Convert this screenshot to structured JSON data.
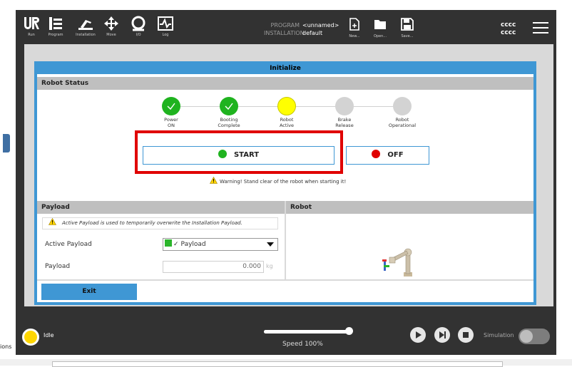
{
  "header": {
    "nav": [
      {
        "label": "Run",
        "icon": "ur-logo-icon"
      },
      {
        "label": "Program",
        "icon": "program-icon"
      },
      {
        "label": "Installation",
        "icon": "installation-icon"
      },
      {
        "label": "Move",
        "icon": "move-icon"
      },
      {
        "label": "I/O",
        "icon": "io-icon"
      },
      {
        "label": "Log",
        "icon": "log-icon"
      }
    ],
    "program_label": "PROGRAM",
    "program_value": "<unnamed>",
    "installation_label": "INSTALLATION",
    "installation_value": "default",
    "file_actions": [
      {
        "label": "New...",
        "icon": "new-file-icon"
      },
      {
        "label": "Open...",
        "icon": "open-folder-icon"
      },
      {
        "label": "Save...",
        "icon": "save-icon"
      }
    ],
    "user_line1": "cccc",
    "user_line2": "cccc"
  },
  "dialog": {
    "title": "Initialize",
    "robot_status": {
      "heading": "Robot Status",
      "steps": [
        {
          "line1": "Power",
          "line2": "ON",
          "state": "done"
        },
        {
          "line1": "Booting",
          "line2": "Complete",
          "state": "done"
        },
        {
          "line1": "Robot",
          "line2": "Active",
          "state": "active"
        },
        {
          "line1": "Brake",
          "line2": "Release",
          "state": "pending"
        },
        {
          "line1": "Robot",
          "line2": "Operational",
          "state": "pending"
        }
      ],
      "start_label": "START",
      "off_label": "OFF",
      "warning": "Warning! Stand clear of the robot when starting it!"
    },
    "payload": {
      "heading": "Payload",
      "note": "Active Payload is used to temporarily overwrite the Installation Payload.",
      "active_payload_label": "Active Payload",
      "active_payload_value": "Payload",
      "payload_label": "Payload",
      "payload_value": "0.000",
      "payload_unit": "kg"
    },
    "robot_heading": "Robot",
    "exit_label": "Exit"
  },
  "footer": {
    "status": "Idle",
    "speed_label": "Speed 100%",
    "speed_fraction": 1.0,
    "simulation_label": "Simulation"
  },
  "side": {
    "actions_label": "ions"
  },
  "colors": {
    "accent": "#3f97d4",
    "ok": "#1fb31f",
    "active": "#ffff00",
    "pending": "#d3d3d3",
    "off": "#e00000",
    "highlight": "#e00000"
  }
}
